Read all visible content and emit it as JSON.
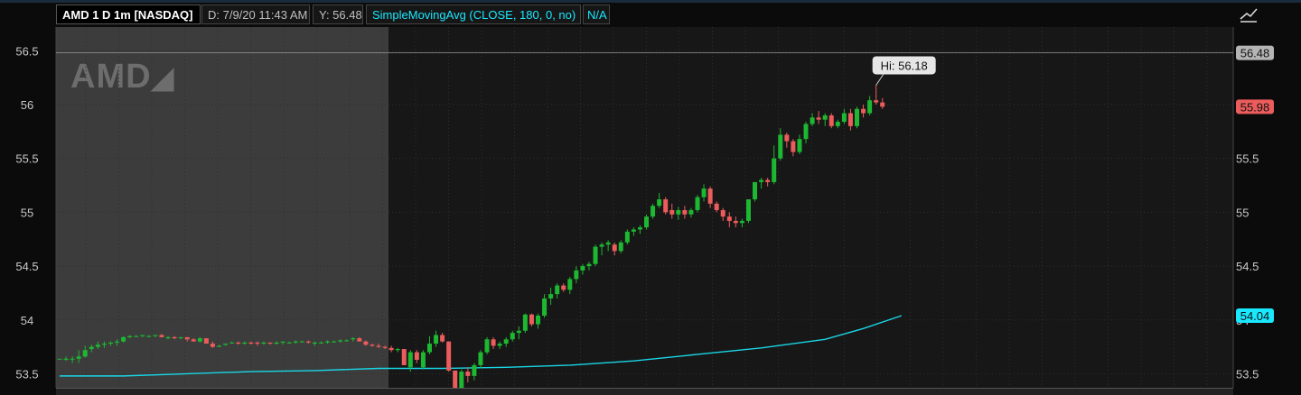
{
  "header": {
    "symbol_label": "AMD 1 D 1m [NASDAQ]",
    "cursor_label": "D: 7/9/20 11:43 AM",
    "y_label": "Y: 56.48",
    "study_label": "SimpleMovingAvg (CLOSE, 180, 0, no)",
    "study_value": "N/A"
  },
  "logo_text": "AMD",
  "colors": {
    "up": "#1db831",
    "down": "#ec5c5c",
    "sma": "#19d6e6",
    "cursor_tag": "#b5b5b5",
    "price_tag": "#ec5c5c",
    "sma_tag": "#19e8ff"
  },
  "tags": {
    "cursor": "56.48",
    "last": "55.98",
    "sma": "54.04",
    "hi": "Hi: 56.18"
  },
  "chart_data": {
    "type": "candlestick",
    "title": "AMD 1 D 1m [NASDAQ]",
    "ylim": [
      53.37,
      56.72
    ],
    "yticks": [
      "53.5",
      "54",
      "54.5",
      "55",
      "55.5",
      "56",
      "56.5"
    ],
    "ytick_values": [
      53.5,
      54,
      54.5,
      55,
      55.5,
      56,
      56.5
    ],
    "cursor_y": 56.48,
    "candles": [
      [
        53.64,
        53.64,
        53.64,
        53.64
      ],
      [
        53.63,
        53.66,
        53.62,
        53.64
      ],
      [
        53.64,
        53.66,
        53.6,
        53.64
      ],
      [
        53.64,
        53.72,
        53.6,
        53.66
      ],
      [
        53.66,
        53.76,
        53.65,
        53.72
      ],
      [
        53.73,
        53.77,
        53.7,
        53.75
      ],
      [
        53.75,
        53.8,
        53.73,
        53.77
      ],
      [
        53.77,
        53.8,
        53.74,
        53.78
      ],
      [
        53.78,
        53.8,
        53.76,
        53.79
      ],
      [
        53.79,
        53.82,
        53.76,
        53.8
      ],
      [
        53.8,
        53.85,
        53.79,
        53.84
      ],
      [
        53.84,
        53.86,
        53.83,
        53.85
      ],
      [
        53.85,
        53.86,
        53.84,
        53.85
      ],
      [
        53.85,
        53.86,
        53.84,
        53.86
      ],
      [
        53.85,
        53.86,
        53.84,
        53.85
      ],
      [
        53.85,
        53.86,
        53.84,
        53.86
      ],
      [
        53.86,
        53.87,
        53.84,
        53.84
      ],
      [
        53.83,
        53.85,
        53.82,
        53.84
      ],
      [
        53.84,
        53.85,
        53.82,
        53.83
      ],
      [
        53.83,
        53.84,
        53.82,
        53.84
      ],
      [
        53.84,
        53.84,
        53.8,
        53.82
      ],
      [
        53.82,
        53.83,
        53.8,
        53.8
      ],
      [
        53.8,
        53.84,
        53.79,
        53.83
      ],
      [
        53.83,
        53.83,
        53.78,
        53.78
      ],
      [
        53.78,
        53.8,
        53.74,
        53.75
      ],
      [
        53.75,
        53.77,
        53.75,
        53.76
      ],
      [
        53.77,
        53.78,
        53.76,
        53.78
      ],
      [
        53.79,
        53.8,
        53.78,
        53.79
      ],
      [
        53.79,
        53.8,
        53.77,
        53.78
      ],
      [
        53.78,
        53.8,
        53.77,
        53.79
      ],
      [
        53.79,
        53.8,
        53.77,
        53.78
      ],
      [
        53.79,
        53.8,
        53.76,
        53.78
      ],
      [
        53.78,
        53.8,
        53.77,
        53.79
      ],
      [
        53.79,
        53.79,
        53.77,
        53.78
      ],
      [
        53.78,
        53.8,
        53.77,
        53.79
      ],
      [
        53.79,
        53.8,
        53.77,
        53.8
      ],
      [
        53.79,
        53.8,
        53.78,
        53.79
      ],
      [
        53.79,
        53.81,
        53.78,
        53.8
      ],
      [
        53.8,
        53.81,
        53.79,
        53.8
      ],
      [
        53.8,
        53.81,
        53.78,
        53.79
      ],
      [
        53.78,
        53.8,
        53.76,
        53.79
      ],
      [
        53.79,
        53.8,
        53.78,
        53.79
      ],
      [
        53.79,
        53.81,
        53.78,
        53.8
      ],
      [
        53.8,
        53.81,
        53.79,
        53.8
      ],
      [
        53.8,
        53.82,
        53.79,
        53.81
      ],
      [
        53.81,
        53.82,
        53.8,
        53.81
      ],
      [
        53.82,
        53.84,
        53.8,
        53.83
      ],
      [
        53.83,
        53.84,
        53.8,
        53.8
      ],
      [
        53.8,
        53.81,
        53.76,
        53.77
      ],
      [
        53.77,
        53.78,
        53.75,
        53.76
      ],
      [
        53.76,
        53.78,
        53.74,
        53.75
      ],
      [
        53.75,
        53.76,
        53.73,
        53.74
      ],
      [
        53.74,
        53.76,
        53.7,
        53.72
      ],
      [
        53.72,
        53.74,
        53.7,
        53.73
      ],
      [
        53.73,
        53.73,
        53.58,
        53.58
      ],
      [
        53.56,
        53.72,
        53.52,
        53.7
      ],
      [
        53.7,
        53.72,
        53.6,
        53.63
      ],
      [
        53.56,
        53.72,
        53.54,
        53.7
      ],
      [
        53.7,
        53.85,
        53.68,
        53.78
      ],
      [
        53.78,
        53.9,
        53.75,
        53.86
      ],
      [
        53.86,
        53.88,
        53.79,
        53.8
      ],
      [
        53.8,
        53.8,
        53.52,
        53.53
      ],
      [
        53.53,
        53.53,
        53.34,
        53.36
      ],
      [
        53.36,
        53.54,
        53.34,
        53.52
      ],
      [
        53.52,
        53.56,
        53.42,
        53.48
      ],
      [
        53.48,
        53.6,
        53.44,
        53.58
      ],
      [
        53.58,
        53.72,
        53.55,
        53.7
      ],
      [
        53.7,
        53.84,
        53.68,
        53.82
      ],
      [
        53.82,
        53.84,
        53.73,
        53.76
      ],
      [
        53.76,
        53.8,
        53.73,
        53.78
      ],
      [
        53.78,
        53.84,
        53.75,
        53.82
      ],
      [
        53.82,
        53.9,
        53.8,
        53.88
      ],
      [
        53.88,
        53.94,
        53.82,
        53.9
      ],
      [
        53.9,
        54.06,
        53.88,
        54.05
      ],
      [
        54.05,
        54.06,
        53.94,
        53.96
      ],
      [
        53.96,
        54.06,
        53.92,
        54.04
      ],
      [
        54.04,
        54.24,
        54.02,
        54.2
      ],
      [
        54.2,
        54.3,
        54.14,
        54.24
      ],
      [
        54.24,
        54.34,
        54.2,
        54.32
      ],
      [
        54.32,
        54.34,
        54.26,
        54.28
      ],
      [
        54.28,
        54.4,
        54.24,
        54.38
      ],
      [
        54.38,
        54.5,
        54.34,
        54.46
      ],
      [
        54.46,
        54.52,
        54.42,
        54.5
      ],
      [
        54.5,
        54.54,
        54.46,
        54.52
      ],
      [
        54.52,
        54.7,
        54.5,
        54.68
      ],
      [
        54.68,
        54.72,
        54.6,
        54.7
      ],
      [
        54.7,
        54.74,
        54.64,
        54.72
      ],
      [
        54.7,
        54.72,
        54.6,
        54.64
      ],
      [
        54.64,
        54.74,
        54.62,
        54.72
      ],
      [
        54.72,
        54.84,
        54.7,
        54.82
      ],
      [
        54.82,
        54.86,
        54.78,
        54.84
      ],
      [
        54.84,
        54.88,
        54.8,
        54.86
      ],
      [
        54.86,
        54.98,
        54.84,
        54.96
      ],
      [
        54.96,
        55.08,
        54.94,
        55.06
      ],
      [
        55.06,
        55.18,
        55.04,
        55.12
      ],
      [
        55.12,
        55.14,
        54.98,
        55
      ],
      [
        55.02,
        55.08,
        54.94,
        54.98
      ],
      [
        54.98,
        55.05,
        54.93,
        55.02
      ],
      [
        55.02,
        55.06,
        54.94,
        54.98
      ],
      [
        54.98,
        55.04,
        54.95,
        55.02
      ],
      [
        55.02,
        55.16,
        55,
        55.14
      ],
      [
        55.14,
        55.26,
        55.1,
        55.22
      ],
      [
        55.22,
        55.24,
        55.04,
        55.08
      ],
      [
        55.08,
        55.1,
        55,
        55.02
      ],
      [
        55.02,
        55.04,
        54.92,
        54.96
      ],
      [
        54.96,
        55,
        54.86,
        54.92
      ],
      [
        54.92,
        54.96,
        54.86,
        54.9
      ],
      [
        54.9,
        54.94,
        54.86,
        54.92
      ],
      [
        54.92,
        55.12,
        54.9,
        55.12
      ],
      [
        55.12,
        55.28,
        55.1,
        55.28
      ],
      [
        55.28,
        55.32,
        55.22,
        55.3
      ],
      [
        55.3,
        55.32,
        55.24,
        55.28
      ],
      [
        55.28,
        55.62,
        55.26,
        55.5
      ],
      [
        55.5,
        55.78,
        55.48,
        55.72
      ],
      [
        55.72,
        55.74,
        55.6,
        55.66
      ],
      [
        55.66,
        55.68,
        55.52,
        55.56
      ],
      [
        55.56,
        55.72,
        55.54,
        55.68
      ],
      [
        55.68,
        55.84,
        55.64,
        55.82
      ],
      [
        55.82,
        55.92,
        55.8,
        55.88
      ],
      [
        55.88,
        55.94,
        55.82,
        55.86
      ],
      [
        55.86,
        55.92,
        55.8,
        55.9
      ],
      [
        55.9,
        55.92,
        55.78,
        55.8
      ],
      [
        55.8,
        55.86,
        55.78,
        55.84
      ],
      [
        55.84,
        55.96,
        55.82,
        55.92
      ],
      [
        55.92,
        55.96,
        55.76,
        55.8
      ],
      [
        55.8,
        55.98,
        55.78,
        55.96
      ],
      [
        55.96,
        56,
        55.88,
        55.92
      ],
      [
        55.92,
        56.08,
        55.9,
        56.04
      ],
      [
        56.04,
        56.18,
        56,
        56.02
      ],
      [
        56.02,
        56.06,
        55.96,
        55.98
      ]
    ],
    "sma": [
      [
        0,
        53.48
      ],
      [
        10,
        53.48
      ],
      [
        20,
        53.5
      ],
      [
        30,
        53.52
      ],
      [
        40,
        53.53
      ],
      [
        50,
        53.55
      ],
      [
        60,
        53.55
      ],
      [
        70,
        53.56
      ],
      [
        80,
        53.58
      ],
      [
        90,
        53.62
      ],
      [
        100,
        53.68
      ],
      [
        110,
        53.74
      ],
      [
        120,
        53.82
      ],
      [
        126,
        53.92
      ],
      [
        132,
        54.04
      ]
    ],
    "sma_series_label": "SimpleMovingAvg (CLOSE, 180, 0, no)",
    "hi_annotation": "Hi: 56.18"
  }
}
